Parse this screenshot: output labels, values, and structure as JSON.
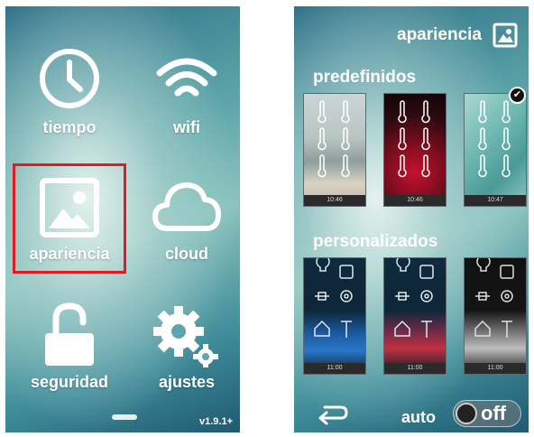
{
  "left_screen": {
    "tiles": [
      {
        "label": "tiempo",
        "icon": "clock-icon"
      },
      {
        "label": "wifi",
        "icon": "wifi-icon"
      },
      {
        "label": "apariencia",
        "icon": "image-icon"
      },
      {
        "label": "cloud",
        "icon": "cloud-icon"
      },
      {
        "label": "seguridad",
        "icon": "unlock-icon"
      },
      {
        "label": "ajustes",
        "icon": "gear-icon"
      }
    ],
    "highlight_color": "#e11b22",
    "version": "v1.9.1+"
  },
  "right_screen": {
    "title": "apariencia",
    "title_icon": "image-icon",
    "section_predefined": "predefinidos",
    "section_custom": "personalizados",
    "predefined_thumbs": [
      {
        "time": "10:46",
        "theme": "beach"
      },
      {
        "time": "10:46",
        "theme": "red-swirl"
      },
      {
        "time": "10:47",
        "theme": "teal-texture",
        "selected": true
      }
    ],
    "custom_thumbs": [
      {
        "time": "11:00",
        "theme": "dark-blue-grid"
      },
      {
        "time": "11:00",
        "theme": "dark-red-grid"
      },
      {
        "time": "11:00",
        "theme": "dark-gray-grid"
      }
    ],
    "auto_label": "auto",
    "toggle_label": "off",
    "back_icon": "return-arrow-icon"
  }
}
